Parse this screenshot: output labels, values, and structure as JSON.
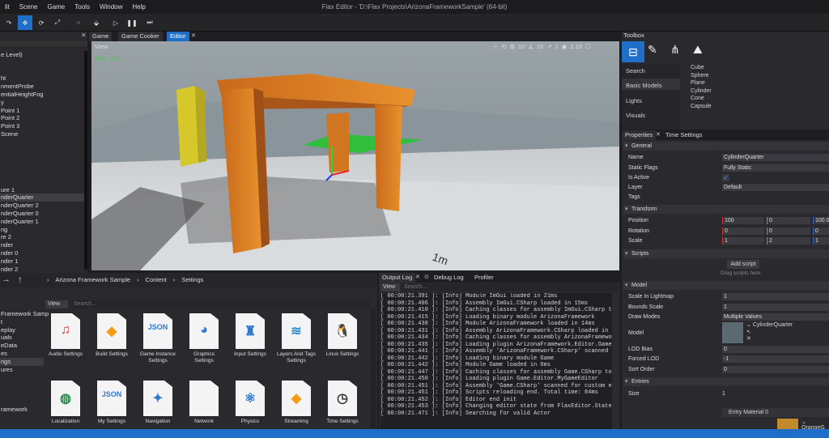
{
  "menu": [
    "lit",
    "Scene",
    "Game",
    "Tools",
    "Window",
    "Help"
  ],
  "window_title": "Flax Editor - 'D:\\Flax Projects\\ArizonaFrameworkSample' (64-bit)",
  "tabs": {
    "game": "Game",
    "game_cooker": "Game Cooker",
    "editor": "Editor"
  },
  "toolbox": {
    "title": "Toolbox",
    "categories": [
      "Search",
      "Basic Models",
      "Lights",
      "Visuals"
    ],
    "items": [
      "Cube",
      "Sphere",
      "Plane",
      "Cylinder",
      "Cone",
      "Capsule"
    ]
  },
  "scene_tree": [
    "e Level)",
    "",
    "",
    "ht",
    "nmentProbe",
    "entialHeightFog",
    "y",
    "Point 1",
    "Point 2",
    "Point 3",
    "Scene",
    "",
    "",
    "",
    "",
    "",
    "",
    "ure 1",
    "nderQuarter",
    "nderQuarter 2",
    "nderQuarter 0",
    "nderQuarter 1",
    "ng",
    "re 2",
    "nder",
    "nder 0",
    "nder 1",
    "nder 2"
  ],
  "viewport": {
    "view_label": "View",
    "fps": "FPS: 120",
    "speed": "10",
    "angle": "15",
    "scale": "1",
    "cam_speed": "2.19"
  },
  "content": {
    "breadcrumb": [
      "Arizona Framework Sample",
      "Content",
      "Settings"
    ],
    "view_label": "View",
    "search_placeholder": "Search...",
    "tree": [
      "Framework Samp",
      "t",
      "eplay",
      "uals",
      "eData",
      "es",
      "ngs",
      "ures",
      "",
      "",
      "",
      "",
      "ramework"
    ],
    "tiles": [
      "Audio Settings",
      "Build Settings",
      "Game Instance Settings",
      "Graphics Settings",
      "Input Settings",
      "Layers And Tags Settings",
      "Linux Settings",
      "Localization",
      "My Settings",
      "Navigation",
      "Network",
      "Physics",
      "Streaming",
      "Time Settings"
    ],
    "tile_icons": [
      "music-note-icon",
      "build-icon",
      "json-icon",
      "graphics-icon",
      "joystick-icon",
      "layers-icon",
      "linux-icon",
      "globe-icon",
      "json-icon",
      "compass-icon",
      "document-icon",
      "atom-icon",
      "streaming-icon",
      "clock-icon"
    ]
  },
  "output": {
    "tabs": [
      "Output Log",
      "Debug Log",
      "Profiler"
    ],
    "view_label": "View",
    "search_placeholder": "Search...",
    "lines": [
      "[ 00:00:21.391 ]: [Info] Module ImGui loaded in 21ms",
      "[ 00:00:21.406 ]: [Info] Assembly ImGui.CSharp loaded in 15ms",
      "[ 00:00:21.410 ]: [Info] Caching classes for assembly ImGui.CSharp too",
      "[ 00:00:21.415 ]: [Info] Loading binary module ArizonaFramework",
      "[ 00:00:21.430 ]: [Info] Module ArizonaFramework loaded in 14ms",
      "[ 00:00:21.431 ]: [Info] Assembly ArizonaFramework.CSharp loaded in 1",
      "[ 00:00:21.434 ]: [Info] Caching classes for assembly ArizonaFramework",
      "[ 00:00:21.435 ]: [Info] Loading plugin ArizonaFramework.Editor.GameIn",
      "[ 00:00:21.441 ]: [Info] Assembly 'ArizonaFramework.CSharp' scanned fo",
      "[ 00:00:21.442 ]: [Info] Loading binary module Game",
      "[ 00:00:21.442 ]: [Info] Module Game loaded in 0ms",
      "[ 00:00:21.447 ]: [Info] Caching classes for assembly Game.CSharp took",
      "[ 00:00:21.450 ]: [Info] Loading plugin Game.Editor.MyGameEditor",
      "[ 00:00:21.451 ]: [Info] Assembly 'Game.CSharp' scanned for custom ed",
      "[ 00:00:21.451 ]: [Info] Scripts reloading end. Total time: 84ms",
      "[ 00:00:21.452 ]: [Info] Editor end init",
      "[ 00:00:21.453 ]: [Info] Changing editor state from FlaxEditor.States",
      "[ 00:00:21.471 ]: [Info] Searching for valid Actor"
    ]
  },
  "properties": {
    "tabs": [
      "Properties",
      "Time Settings"
    ],
    "general": {
      "title": "General",
      "name_label": "Name",
      "name_value": "CylinderQuarter",
      "static_label": "Static Flags",
      "static_value": "Fully Static",
      "active_label": "Is Active",
      "layer_label": "Layer",
      "layer_value": "Default",
      "tags_label": "Tags"
    },
    "transform": {
      "title": "Transform",
      "position_label": "Position",
      "position": [
        "100",
        "0",
        "100.0"
      ],
      "rotation_label": "Rotation",
      "rotation": [
        "0",
        "0",
        "0"
      ],
      "scale_label": "Scale",
      "scale": [
        "1",
        "2",
        "1"
      ]
    },
    "scripts": {
      "title": "Scripts",
      "add": "Add script",
      "hint": "Drag scripts here"
    },
    "model": {
      "title": "Model",
      "lightmap_label": "Scale In Lightmap",
      "lightmap_value": "1",
      "bounds_label": "Bounds Scale",
      "bounds_value": "1",
      "draw_label": "Draw Modes",
      "draw_value": "Multiple Values",
      "model_label": "Model",
      "model_value": "CylinderQuarter",
      "lod_bias_label": "LOD Bias",
      "lod_bias_value": "0",
      "forced_lod_label": "Forced LOD",
      "forced_lod_value": "-1",
      "sort_label": "Sort Order",
      "sort_value": "0"
    },
    "entries": {
      "title": "Entries",
      "size_label": "Size",
      "size_value": "1",
      "entry_label": "Entry Material 0",
      "entry_value": "OrangeG"
    }
  },
  "colors": {
    "accent": "#1f6ec8",
    "panel": "#2a2a2e",
    "menubar": "#1c1c1f"
  }
}
